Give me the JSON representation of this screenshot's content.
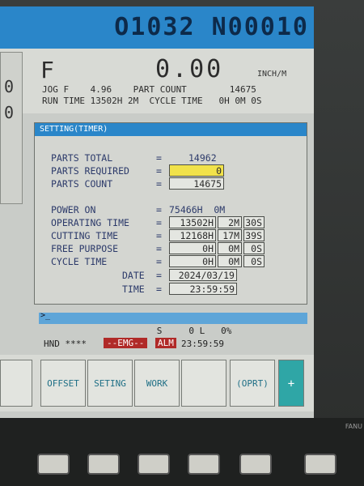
{
  "header": {
    "program": "O1032 N00010"
  },
  "position": {
    "label": "F",
    "value": "0.00",
    "unit": "INCH/M"
  },
  "info": {
    "line1": "JOG F    4.96    PART COUNT        14675",
    "line2": "RUN TIME 13502H 2M  CYCLE TIME   0H 0M 0S"
  },
  "left_stub": {
    "char1": "0",
    "char2": "0"
  },
  "window": {
    "title": "SETTING(TIMER)",
    "parts_total_label": "PARTS TOTAL",
    "parts_total": "14962",
    "parts_required_label": "PARTS REQUIRED",
    "parts_required": "0",
    "parts_count_label": "PARTS COUNT",
    "parts_count": "14675",
    "power_on_label": "POWER ON",
    "power_on": "75466H  0M",
    "operating_time_label": "OPERATING TIME",
    "operating_time": {
      "h": "13502H",
      "m": "2M",
      "s": "30S"
    },
    "cutting_time_label": "CUTTING TIME",
    "cutting_time": {
      "h": "12168H",
      "m": "17M",
      "s": "39S"
    },
    "free_purpose_label": "FREE PURPOSE",
    "free_purpose": {
      "h": "0H",
      "m": "0M",
      "s": "0S"
    },
    "cycle_time_label": "CYCLE TIME",
    "cycle_time": {
      "h": "0H",
      "m": "0M",
      "s": "0S"
    },
    "date_label": "DATE",
    "date": "2024/03/19",
    "time_label": "TIME",
    "time": "23:59:59",
    "eq": "="
  },
  "cmd": {
    "prompt": ">_"
  },
  "statline": "                      S     0 L   0%",
  "mode": {
    "hnd": "HND ****",
    "emg": "--EMG--",
    "alm": "ALM",
    "clock": "23:59:59"
  },
  "softkeys": [
    "",
    "OFFSET",
    "SETING",
    "WORK",
    "",
    "(OPRT)",
    "+"
  ],
  "panel": {
    "brand": "FANU"
  },
  "colors": {
    "title_bar": "#2a86c9",
    "emg": "#b02a28",
    "highlight": "#f1e24a"
  }
}
